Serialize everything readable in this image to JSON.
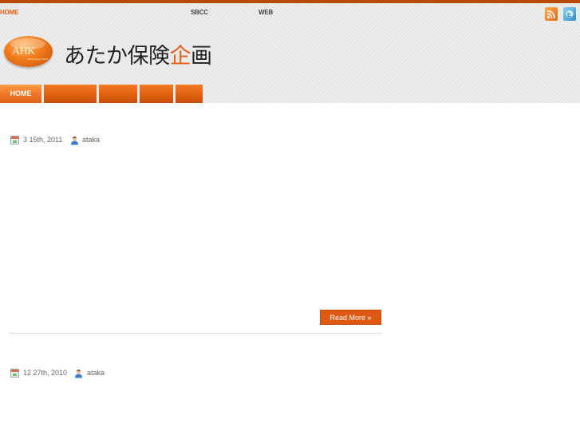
{
  "topbar": {
    "links": [
      {
        "label": "HOME",
        "active": true
      },
      {
        "label": "SBCC",
        "active": false
      },
      {
        "label": "WEB",
        "active": false
      }
    ],
    "social": [
      {
        "name": "rss-icon",
        "color": "#f07a1c"
      },
      {
        "name": "twitter-icon",
        "color": "#3a9ad0"
      }
    ]
  },
  "branding": {
    "logo_text": "AHK",
    "logo_sub": "Ataka Hoken Kikaku",
    "title_pre": "あたか保険",
    "title_accent": "企",
    "title_post": "画"
  },
  "nav": {
    "items": [
      {
        "label": "HOME",
        "active": true
      },
      {
        "label": "",
        "active": false
      },
      {
        "label": "",
        "active": false
      },
      {
        "label": "",
        "active": false
      },
      {
        "label": "",
        "active": false
      }
    ]
  },
  "posts": [
    {
      "date": "3  15th, 2011",
      "author": "ataka",
      "read_more": "Read More »"
    },
    {
      "date": "12  27th, 2010",
      "author": "ataka"
    }
  ],
  "colors": {
    "accent": "#e8601a",
    "topbar": "#b84a0d",
    "button": "#de5a12"
  }
}
